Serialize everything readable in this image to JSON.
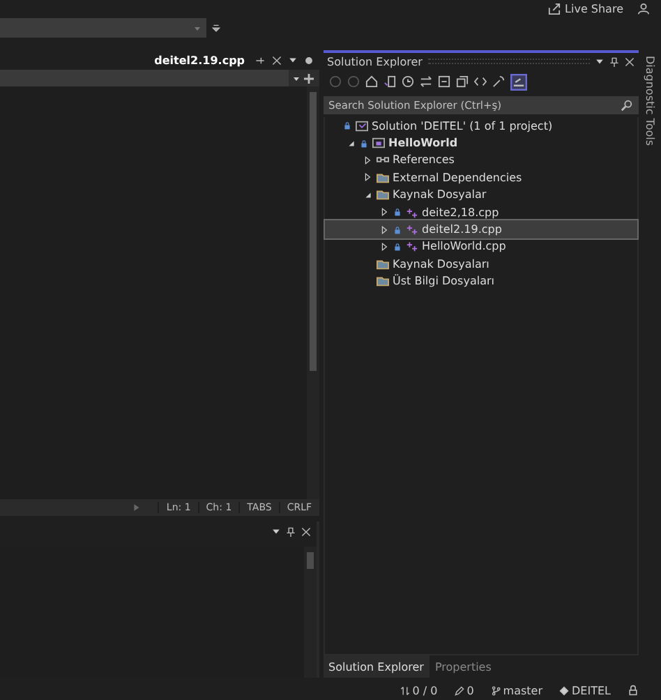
{
  "title_bar": {
    "live_share": "Live Share"
  },
  "editor": {
    "tab": {
      "label": "deitel2.19.cpp",
      "selected": true
    },
    "status": {
      "line": "Ln: 1",
      "column": "Ch: 1",
      "indent": "TABS",
      "line_ending": "CRLF"
    }
  },
  "solution_explorer": {
    "title": "Solution Explorer",
    "search": {
      "placeholder": "Search Solution Explorer (Ctrl+ş)"
    },
    "tree": [
      {
        "kind": "solution",
        "label": "Solution 'DEITEL' (1 of 1 project)",
        "selected": false,
        "children": [
          {
            "kind": "project",
            "label": "HelloWorld",
            "expanded": true,
            "selected": false,
            "children": [
              {
                "kind": "references",
                "label": "References",
                "expanded": false,
                "selected": false
              },
              {
                "kind": "folder",
                "label": "External Dependencies",
                "expanded": false,
                "selected": false
              },
              {
                "kind": "folder",
                "label": "Kaynak Dosyalar",
                "expanded": true,
                "selected": false,
                "children": [
                  {
                    "kind": "file",
                    "label": "deite2,18.cpp",
                    "expanded": false,
                    "selected": false
                  },
                  {
                    "kind": "file",
                    "label": "deitel2.19.cpp",
                    "expanded": false,
                    "selected": true
                  },
                  {
                    "kind": "file",
                    "label": "HelloWorld.cpp",
                    "expanded": false,
                    "selected": false
                  }
                ]
              },
              {
                "kind": "folder",
                "label": "Kaynak Dosyaları",
                "selected": false
              },
              {
                "kind": "folder",
                "label": "Üst Bilgi Dosyaları",
                "selected": false
              }
            ]
          }
        ]
      }
    ],
    "tabs": [
      {
        "label": "Solution Explorer",
        "selected": true
      },
      {
        "label": "Properties",
        "selected": false
      }
    ]
  },
  "side_tab": {
    "label": "Diagnostic Tools"
  },
  "status_bar": {
    "changes": "0 / 0",
    "edits": "0",
    "branch": "master",
    "repository": "DEITEL"
  }
}
